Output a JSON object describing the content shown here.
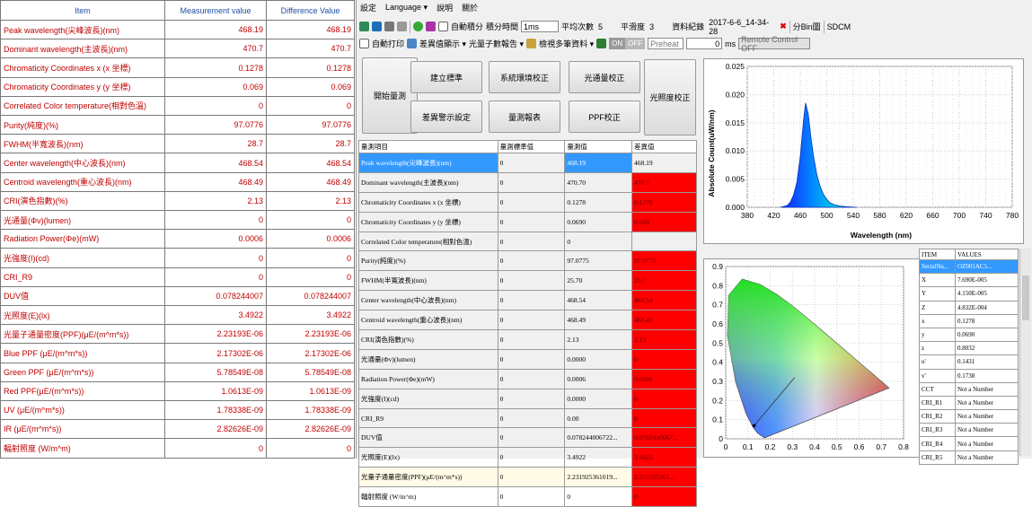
{
  "left_table": {
    "headers": [
      "Item",
      "Measurement value",
      "Difference Value"
    ],
    "rows": [
      [
        "Peak wavelength(尖峰波長)(nm)",
        "468.19",
        "468.19"
      ],
      [
        "Dominant wavelength(主波長)(nm)",
        "470.7",
        "470.7"
      ],
      [
        "Chromaticity Coordinates x (x 坐標)",
        "0.1278",
        "0.1278"
      ],
      [
        "Chromaticity Coordinates y (y 坐標)",
        "0.069",
        "0.069"
      ],
      [
        "Correlated Color temperature(相對色溫)",
        "0",
        "0"
      ],
      [
        "Purity(純度)(%)",
        "97.0776",
        "97.0776"
      ],
      [
        "FWHM(半寬波長)(nm)",
        "28.7",
        "28.7"
      ],
      [
        "Center wavelength(中心波長)(nm)",
        "468.54",
        "468.54"
      ],
      [
        "Centroid wavelength(重心波長)(nm)",
        "468.49",
        "468.49"
      ],
      [
        "CRI(演色指數)(%)",
        "2.13",
        "2.13"
      ],
      [
        "光通量(Φv)(lumen)",
        "0",
        "0"
      ],
      [
        "Radiation Power(Φe)(mW)",
        "0.0006",
        "0.0006"
      ],
      [
        "光強度(I)(cd)",
        "0",
        "0"
      ],
      [
        "CRI_R9",
        "0",
        "0"
      ],
      [
        "DUV值",
        "0.078244007",
        "0.078244007"
      ],
      [
        "光照度(E)(lx)",
        "3.4922",
        "3.4922"
      ],
      [
        "光量子通量密度(PPF)(μE/(m^m*s))",
        "2.23193E-06",
        "2.23193E-06"
      ],
      [
        "Blue PPF (μE/(m^m*s))",
        "2.17302E-06",
        "2.17302E-06"
      ],
      [
        "Green PPF (μE/(m^m*s))",
        "5.78549E-08",
        "5.78549E-08"
      ],
      [
        "Red PPF(μE/(m^m*s))",
        "1.0613E-09",
        "1.0613E-09"
      ],
      [
        "UV (μE/(m^m*s))",
        "1.78338E-09",
        "1.78338E-09"
      ],
      [
        "IR (μE/(m^m*s))",
        "2.82626E-09",
        "2.82626E-09"
      ],
      [
        "輻射照度 (W/m^m)",
        "0",
        "0"
      ]
    ]
  },
  "menu": [
    "設定",
    "Language ▾",
    "說明",
    "關於"
  ],
  "toolbar1": {
    "auto_integration": "自動積分",
    "integration_label": "積分時間",
    "integration_value": "1ms",
    "avg_label": "平均次數",
    "avg_value": "5",
    "smooth_label": "平滑度",
    "smooth_value": "3",
    "record_label": "資料紀錄",
    "record_value": "2017-6-6_14-34-28",
    "split_label": "分Bin圖",
    "sdcm_label": "SDCM"
  },
  "toolbar2": {
    "auto_print": "自動打印",
    "diff_display": "差異值顯示 ▾",
    "photon_report": "光量子數報告 ▾",
    "multi_data": "檢視多筆資料 ▾",
    "on_label": "ON",
    "off_label": "OFF",
    "preheat_label": "Preheat",
    "preheat_value": "0",
    "ms_label": "ms",
    "remote_label": "Remote Control OFF"
  },
  "buttons": {
    "start": "開始量測",
    "build_std": "建立標準",
    "sys_env": "系統環境校正",
    "flux_cal": "光通量校正",
    "irr_cal": "光照度校正",
    "diff_setting": "差異警示設定",
    "meas_report": "量測報表",
    "ppf_cal": "PPF校正"
  },
  "meas_table": {
    "headers": [
      "量測項目",
      "量測標準值",
      "量測值",
      "差異值"
    ],
    "rows": [
      [
        "Peak wavelength(尖峰波長)(nm)",
        "0",
        "468.19",
        "468.19"
      ],
      [
        "Dominant wavelength(主波長)(nm)",
        "0",
        "470.70",
        "470.7"
      ],
      [
        "Chromaticity Coordinates x (x 坐標)",
        "0",
        "0.1278",
        "0.1278"
      ],
      [
        "Chromaticity Coordinates y (y 坐標)",
        "0",
        "0.0690",
        "0.069"
      ],
      [
        "Correlated Color temperature(相對色溫)",
        "0",
        "0",
        ""
      ],
      [
        "Purity(純度)(%)",
        "0",
        "97.0775",
        "97.0775"
      ],
      [
        "FWHM(半寬波長)(nm)",
        "0",
        "25.70",
        "25.7"
      ],
      [
        "Center wavelength(中心波長)(nm)",
        "0",
        "468.54",
        "468.54"
      ],
      [
        "Centroid wavelength(重心波長)(nm)",
        "0",
        "468.49",
        "468.49"
      ],
      [
        "CRI(演色指數)(%)",
        "0",
        "2.13",
        "2.13"
      ],
      [
        "光通量(Φv)(lumen)",
        "0",
        "0.0000",
        "0"
      ],
      [
        "Radiation Power(Φe)(mW)",
        "0",
        "0.0006",
        "0.0006"
      ],
      [
        "光強度(I)(cd)",
        "0",
        "0.0000",
        "0"
      ],
      [
        "CRI_R9",
        "0",
        "0.00",
        "0"
      ],
      [
        "DUV值",
        "0",
        "0.078244006722...",
        "0.0782440067..."
      ],
      [
        "光照度(E)(lx)",
        "0",
        "3.4922",
        "3.4922"
      ],
      [
        "光量子通量密度(PPF)(μE/(m^m*s))",
        "0",
        "2.231925361019...",
        "2.231925361..."
      ],
      [
        "輻射照度 (W/m^m)",
        "0",
        "0",
        "0"
      ]
    ]
  },
  "spectrum_chart": {
    "ylabel": "Absolute Count(uW/nm)",
    "xlabel": "Wavelength (nm)"
  },
  "chart_data": [
    {
      "type": "area",
      "ylabel": "Absolute Count(uW/nm)",
      "xlabel": "Wavelength (nm)",
      "xlim": [
        380,
        780
      ],
      "ylim": [
        0,
        0.025
      ],
      "xticks": [
        "380",
        "420",
        "460",
        "500",
        "540",
        "580",
        "620",
        "660",
        "700",
        "740",
        "780"
      ],
      "yticks": [
        "0.000",
        "0.005",
        "0.010",
        "0.015",
        "0.020",
        "0.025"
      ],
      "grid": true,
      "x": [
        430,
        440,
        445,
        450,
        455,
        460,
        465,
        468,
        472,
        476,
        480,
        485,
        490,
        495,
        500,
        505,
        510,
        520,
        530,
        545
      ],
      "y": [
        0,
        0.0003,
        0.0009,
        0.0022,
        0.0045,
        0.009,
        0.0155,
        0.0185,
        0.0165,
        0.0125,
        0.009,
        0.0058,
        0.0037,
        0.0023,
        0.0014,
        0.0008,
        0.0005,
        0.0002,
        0.0001,
        0
      ]
    },
    {
      "type": "scatter",
      "xlim": [
        0,
        0.8
      ],
      "ylim": [
        0,
        0.9
      ],
      "xticks": [
        "0",
        "0.1",
        "0.2",
        "0.3",
        "0.4",
        "0.5",
        "0.6",
        "0.7",
        "0.8"
      ],
      "yticks": [
        "0",
        "0.1",
        "0.2",
        "0.3",
        "0.4",
        "0.5",
        "0.6",
        "0.7",
        "0.8",
        "0.9"
      ],
      "grid": true,
      "point": {
        "x": 0.1278,
        "y": 0.069
      }
    }
  ],
  "values_table": {
    "headers": [
      "ITEM",
      "VALUES"
    ],
    "rows": [
      [
        "SerialNu...",
        "OZ001AC5..."
      ],
      [
        "X",
        "7.690E-005"
      ],
      [
        "Y",
        "4.150E-005"
      ],
      [
        "Z",
        "4.832E-004"
      ],
      [
        "x",
        "0.1278"
      ],
      [
        "y",
        "0.0690"
      ],
      [
        "z",
        "0.8032"
      ],
      [
        "u'",
        "0.1431"
      ],
      [
        "v'",
        "0.1738"
      ],
      [
        "CCT",
        "Not a Number"
      ],
      [
        "CRI_R1",
        "Not a Number"
      ],
      [
        "CRI_R2",
        "Not a Number"
      ],
      [
        "CRI_R3",
        "Not a Number"
      ],
      [
        "CRI_R4",
        "Not a Number"
      ],
      [
        "CRI_R5",
        "Not a Number"
      ]
    ]
  },
  "colors": {
    "accent_red": "#ff0000",
    "selection_blue": "#3399ff",
    "left_text_red": "#c00000",
    "header_blue": "#1f4fa8"
  }
}
